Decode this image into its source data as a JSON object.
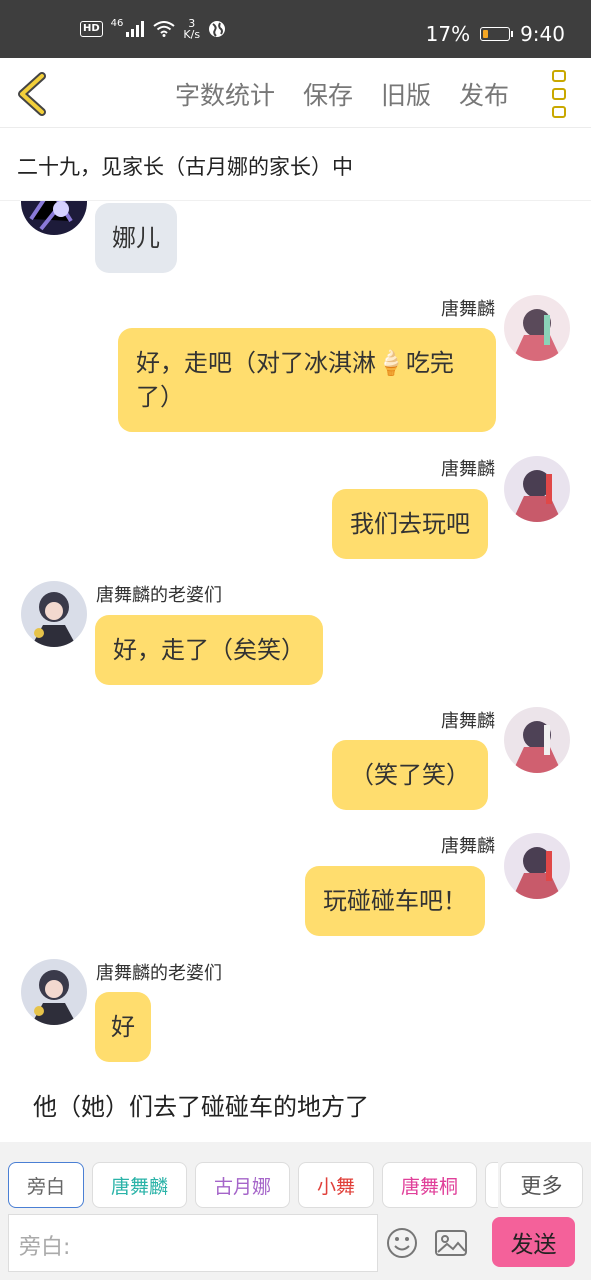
{
  "status_bar": {
    "hd": "HD",
    "network": "46",
    "speed_value": "3",
    "speed_unit": "K/s",
    "battery": "17%",
    "time": "9:40"
  },
  "header": {
    "actions": [
      "字数统计",
      "保存",
      "旧版",
      "发布"
    ]
  },
  "chapter_title": "二十九，见家长（古月娜的家长）中",
  "messages": [
    {
      "side": "left",
      "name": "",
      "text": "娜儿",
      "style": "grey"
    },
    {
      "side": "right",
      "name": "唐舞麟",
      "text": "好，走吧（对了冰淇淋🍦吃完了）",
      "style": "yellow"
    },
    {
      "side": "right",
      "name": "唐舞麟",
      "text": "我们去玩吧",
      "style": "yellow"
    },
    {
      "side": "left",
      "name": "唐舞麟的老婆们",
      "text": "好，走了（矣笑）",
      "style": "yellow"
    },
    {
      "side": "right",
      "name": "唐舞麟",
      "text": "（笑了笑）",
      "style": "yellow"
    },
    {
      "side": "right",
      "name": "唐舞麟",
      "text": "玩碰碰车吧！",
      "style": "yellow"
    },
    {
      "side": "left",
      "name": "唐舞麟的老婆们",
      "text": "好",
      "style": "yellow"
    }
  ],
  "narration": "他（她）们去了碰碰车的地方了",
  "roles": [
    {
      "label": "旁白",
      "color": "#666666"
    },
    {
      "label": "唐舞麟",
      "color": "#2bb3a8"
    },
    {
      "label": "古月娜",
      "color": "#a565c9"
    },
    {
      "label": "小舞",
      "color": "#e0403a"
    },
    {
      "label": "唐舞桐",
      "color": "#e0409a"
    }
  ],
  "more_roles": "更多",
  "input_placeholder": "旁白:",
  "send_label": "发送",
  "colors": {
    "accent_yellow": "#ffdd6e",
    "send_pink": "#f4619a",
    "back_arrow": "#c9a800"
  }
}
